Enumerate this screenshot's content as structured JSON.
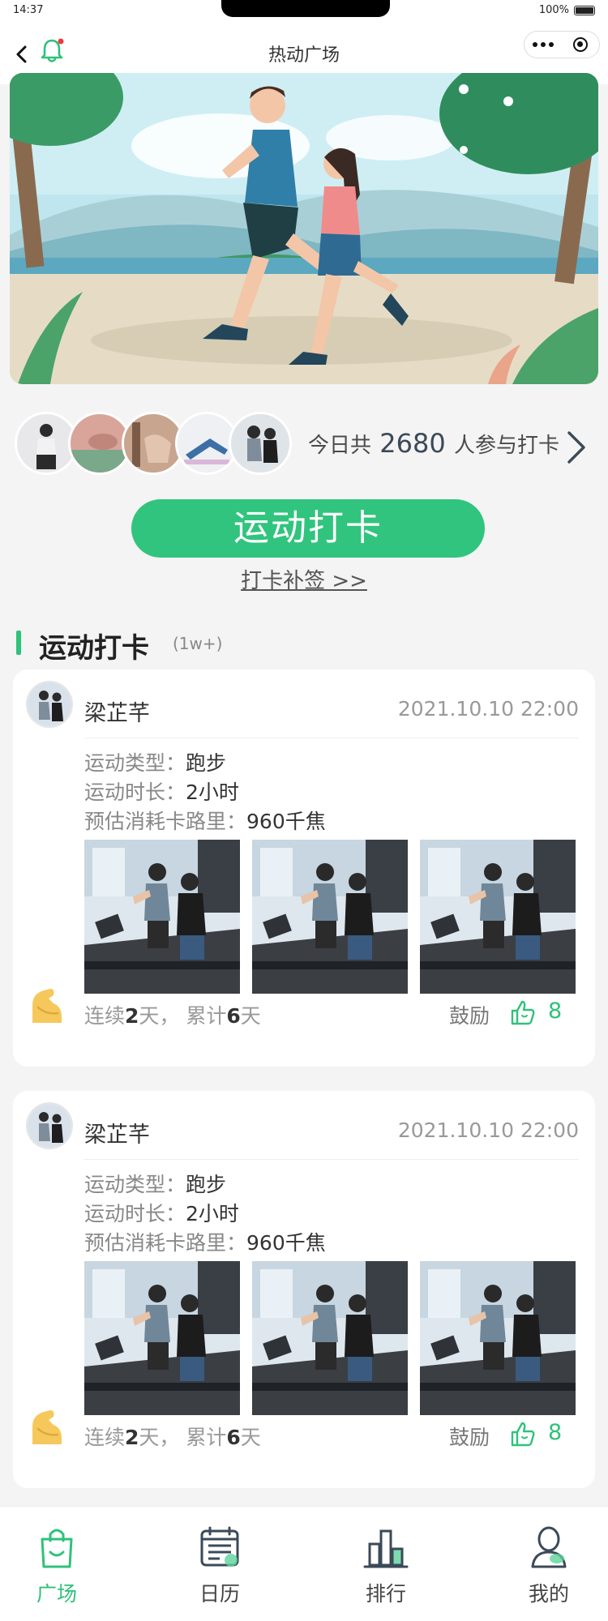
{
  "status_bar": {
    "time": "14:37",
    "battery": "100%"
  },
  "nav": {
    "title": "热动广场"
  },
  "participants": {
    "prefix": "今日共",
    "count": "2680",
    "suffix": "人参与打卡"
  },
  "checkin_button": "运动打卡",
  "supplement_link": "打卡补签 >>",
  "section": {
    "title": "运动打卡",
    "count": "(1w+)"
  },
  "posts": [
    {
      "name": "梁芷芊",
      "time": "2021.10.10 22:00",
      "type_label": "运动类型：",
      "type_value": "跑步",
      "duration_label": "运动时长：",
      "duration_value": "2小时",
      "calorie_label": "预估消耗卡路里：",
      "calorie_value": "960千焦",
      "streak_prefix": "连续",
      "streak_days": "2",
      "streak_mid": "天，  累计",
      "total_days": "6",
      "streak_suffix": "天",
      "cheer_label": "鼓励",
      "likes": "8"
    },
    {
      "name": "梁芷芊",
      "time": "2021.10.10 22:00",
      "type_label": "运动类型：",
      "type_value": "跑步",
      "duration_label": "运动时长：",
      "duration_value": "2小时",
      "calorie_label": "预估消耗卡路里：",
      "calorie_value": "960千焦",
      "streak_prefix": "连续",
      "streak_days": "2",
      "streak_mid": "天，  累计",
      "total_days": "6",
      "streak_suffix": "天",
      "cheer_label": "鼓励",
      "likes": "8"
    }
  ],
  "tabs": [
    {
      "label": "广场",
      "icon": "shopping-bag-icon",
      "active": true
    },
    {
      "label": "日历",
      "icon": "calendar-icon",
      "active": false
    },
    {
      "label": "排行",
      "icon": "ranking-icon",
      "active": false
    },
    {
      "label": "我的",
      "icon": "profile-icon",
      "active": false
    }
  ],
  "colors": {
    "accent": "#31c47e",
    "background": "#f4f4f4",
    "card": "#ffffff"
  }
}
